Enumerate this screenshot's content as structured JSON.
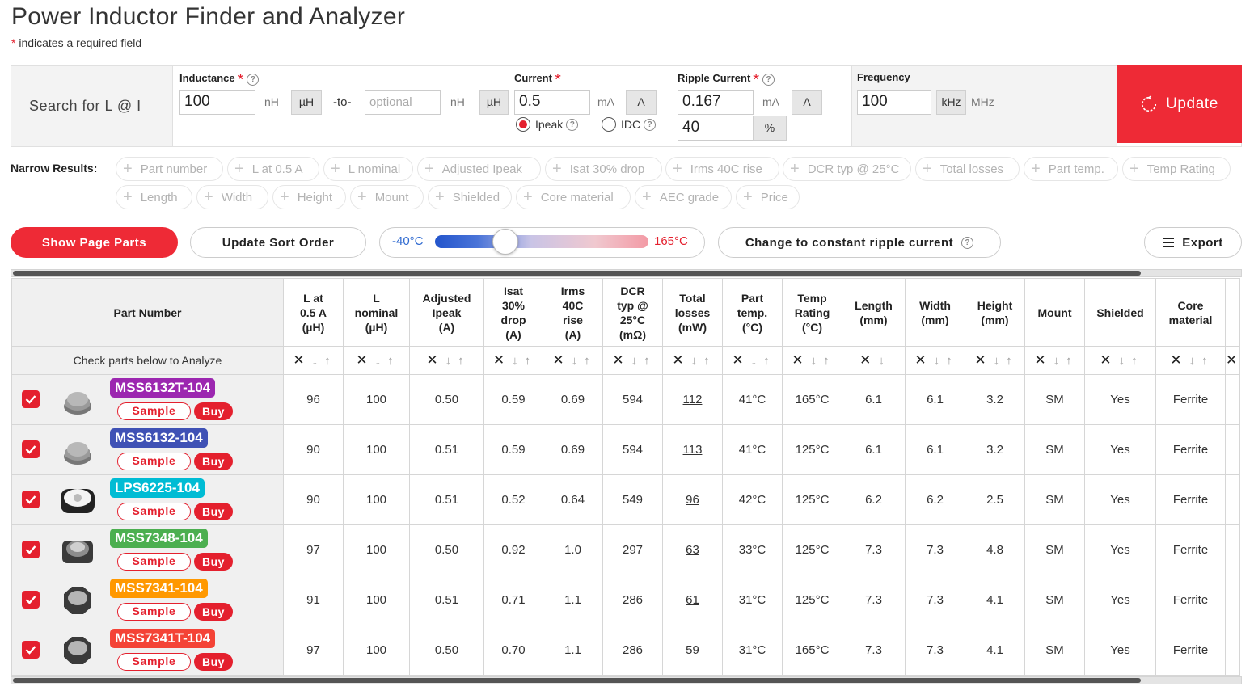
{
  "page": {
    "title": "Power Inductor Finder and Analyzer",
    "required_star": "*",
    "required_note": " indicates a required field"
  },
  "search": {
    "label": "Search for L @ I",
    "inductance_label": "Inductance",
    "inductance_value": "100",
    "unit_nh": "nH",
    "unit_uh": "µH",
    "to_label": "-to-",
    "to_placeholder": "optional",
    "current_label": "Current",
    "current_value": "0.5",
    "unit_ma": "mA",
    "unit_a": "A",
    "ipeak_label": "Ipeak",
    "idc_label": "IDC",
    "ripple_label": "Ripple Current",
    "ripple_value": "0.167",
    "ripple_percent_value": "40",
    "unit_percent": "%",
    "frequency_label": "Frequency",
    "frequency_value": "100",
    "unit_khz": "kHz",
    "unit_mhz": "MHz",
    "update_label": "Update",
    "help_glyph": "?"
  },
  "narrow": {
    "label": "Narrow Results:",
    "chips": [
      "Part number",
      "L at 0.5 A",
      "L nominal",
      "Adjusted Ipeak",
      "Isat 30% drop",
      "Irms 40C rise",
      "DCR typ @ 25°C",
      "Total losses",
      "Part temp.",
      "Temp Rating",
      "Length",
      "Width",
      "Height",
      "Mount",
      "Shielded",
      "Core material",
      "AEC grade",
      "Price"
    ]
  },
  "toolbar": {
    "show_parts": "Show Page Parts",
    "update_sort": "Update Sort Order",
    "temp_min": "-40°C",
    "temp_max": "165°C",
    "ripple_toggle": "Change to constant ripple current",
    "export": "Export"
  },
  "table": {
    "part_header": "Part Number",
    "part_subheader": "Check parts below to Analyze",
    "columns": [
      [
        "L at",
        "0.5 A",
        "(µH)"
      ],
      [
        "L",
        "nominal",
        "(µH)"
      ],
      [
        "Adjusted",
        "Ipeak",
        "(A)"
      ],
      [
        "Isat",
        "30%",
        "drop",
        "(A)"
      ],
      [
        "Irms",
        "40C",
        "rise",
        "(A)"
      ],
      [
        "DCR",
        "typ @",
        "25°C",
        "(mΩ)"
      ],
      [
        "Total",
        "losses",
        "(mW)"
      ],
      [
        "Part",
        "temp.",
        "(°C)"
      ],
      [
        "Temp",
        "Rating",
        "(°C)"
      ],
      [
        "Length",
        "(mm)"
      ],
      [
        "Width",
        "(mm)"
      ],
      [
        "Height",
        "(mm)"
      ],
      [
        "Mount"
      ],
      [
        "Shielded"
      ],
      [
        "Core",
        "material"
      ]
    ],
    "sample_label": "Sample",
    "buy_label": "Buy",
    "rows": [
      {
        "part": "MSS6132T-104",
        "color": "#9c27b0",
        "values": [
          "96",
          "100",
          "0.50",
          "0.59",
          "0.69",
          "594",
          "112",
          "41°C",
          "165°C",
          "6.1",
          "6.1",
          "3.2",
          "SM",
          "Yes",
          "Ferrite"
        ]
      },
      {
        "part": "MSS6132-104",
        "color": "#3f51b5",
        "values": [
          "90",
          "100",
          "0.51",
          "0.59",
          "0.69",
          "594",
          "113",
          "41°C",
          "125°C",
          "6.1",
          "6.1",
          "3.2",
          "SM",
          "Yes",
          "Ferrite"
        ]
      },
      {
        "part": "LPS6225-104",
        "color": "#00bcd4",
        "values": [
          "90",
          "100",
          "0.51",
          "0.52",
          "0.64",
          "549",
          "96",
          "42°C",
          "125°C",
          "6.2",
          "6.2",
          "2.5",
          "SM",
          "Yes",
          "Ferrite"
        ]
      },
      {
        "part": "MSS7348-104",
        "color": "#4caf50",
        "values": [
          "97",
          "100",
          "0.50",
          "0.92",
          "1.0",
          "297",
          "63",
          "33°C",
          "125°C",
          "7.3",
          "7.3",
          "4.8",
          "SM",
          "Yes",
          "Ferrite"
        ]
      },
      {
        "part": "MSS7341-104",
        "color": "#ff9800",
        "values": [
          "91",
          "100",
          "0.51",
          "0.71",
          "1.1",
          "286",
          "61",
          "31°C",
          "125°C",
          "7.3",
          "7.3",
          "4.1",
          "SM",
          "Yes",
          "Ferrite"
        ]
      },
      {
        "part": "MSS7341T-104",
        "color": "#f44336",
        "values": [
          "97",
          "100",
          "0.50",
          "0.70",
          "1.1",
          "286",
          "59",
          "31°C",
          "165°C",
          "7.3",
          "7.3",
          "4.1",
          "SM",
          "Yes",
          "Ferrite"
        ]
      }
    ]
  },
  "colors": {
    "accent": "#ee2a36"
  }
}
